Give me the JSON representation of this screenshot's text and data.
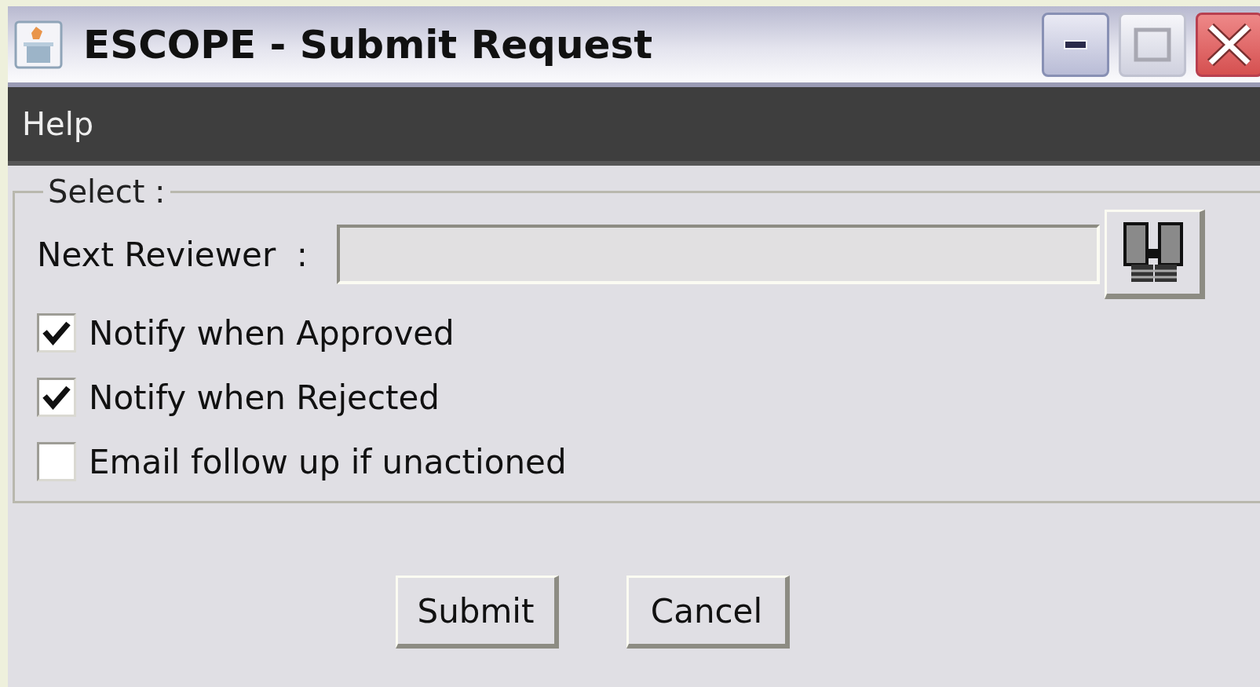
{
  "window": {
    "title": "ESCOPE - Submit Request"
  },
  "menu": [
    {
      "label": "Help"
    }
  ],
  "group": {
    "legend": "Select :"
  },
  "reviewer": {
    "label": "Next Reviewer  :"
  },
  "options": [
    {
      "label": "Notify when Approved",
      "checked": true
    },
    {
      "label": "Notify when Rejected",
      "checked": true
    },
    {
      "label": "Email follow up if unactioned",
      "checked": false
    }
  ],
  "buttons": [
    {
      "label": "Submit"
    },
    {
      "label": "Cancel"
    }
  ]
}
